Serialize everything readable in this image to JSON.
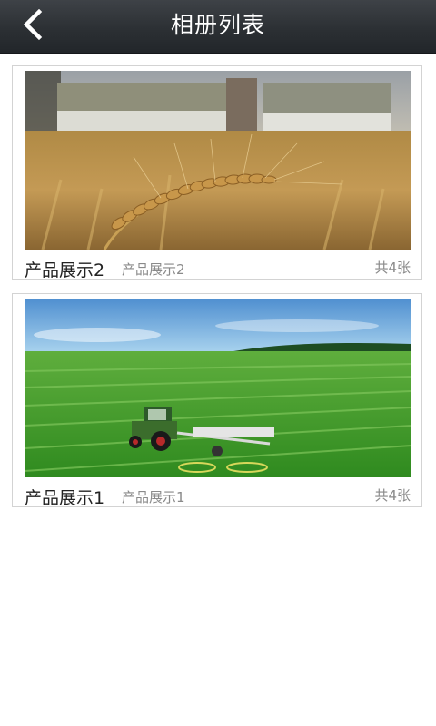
{
  "header": {
    "title": "相册列表",
    "back_icon": "chevron-left-icon"
  },
  "albums": [
    {
      "name": "产品展示2",
      "description": "产品展示2",
      "count": "共4张",
      "image": "wheat-field-photo"
    },
    {
      "name": "产品展示1",
      "description": "产品展示1",
      "count": "共4张",
      "image": "tractor-field-photo"
    }
  ],
  "colors": {
    "header_bg": "#2c3034",
    "title_text": "#ffffff",
    "card_border": "#d3d3d3",
    "muted_text": "#8a8a8a"
  }
}
